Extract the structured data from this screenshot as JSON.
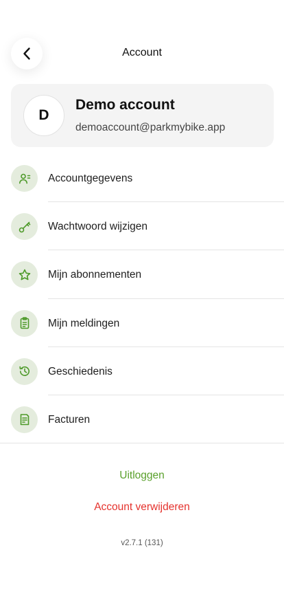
{
  "header": {
    "title": "Account"
  },
  "profile": {
    "initial": "D",
    "name": "Demo account",
    "email": "demoaccount@parkmybike.app"
  },
  "menu": {
    "items": [
      {
        "label": "Accountgegevens",
        "icon": "user-details-icon"
      },
      {
        "label": "Wachtwoord wijzigen",
        "icon": "key-icon"
      },
      {
        "label": "Mijn abonnementen",
        "icon": "star-icon"
      },
      {
        "label": "Mijn meldingen",
        "icon": "clipboard-icon"
      },
      {
        "label": "Geschiedenis",
        "icon": "history-icon"
      },
      {
        "label": "Facturen",
        "icon": "receipt-icon"
      }
    ]
  },
  "actions": {
    "logout_label": "Uitloggen",
    "delete_label": "Account verwijderen"
  },
  "version": "v2.7.1 (131)",
  "colors": {
    "accent": "#5aa02c",
    "icon_bg": "#e4ecdd",
    "danger": "#e5322d",
    "card_bg": "#f4f4f4"
  }
}
